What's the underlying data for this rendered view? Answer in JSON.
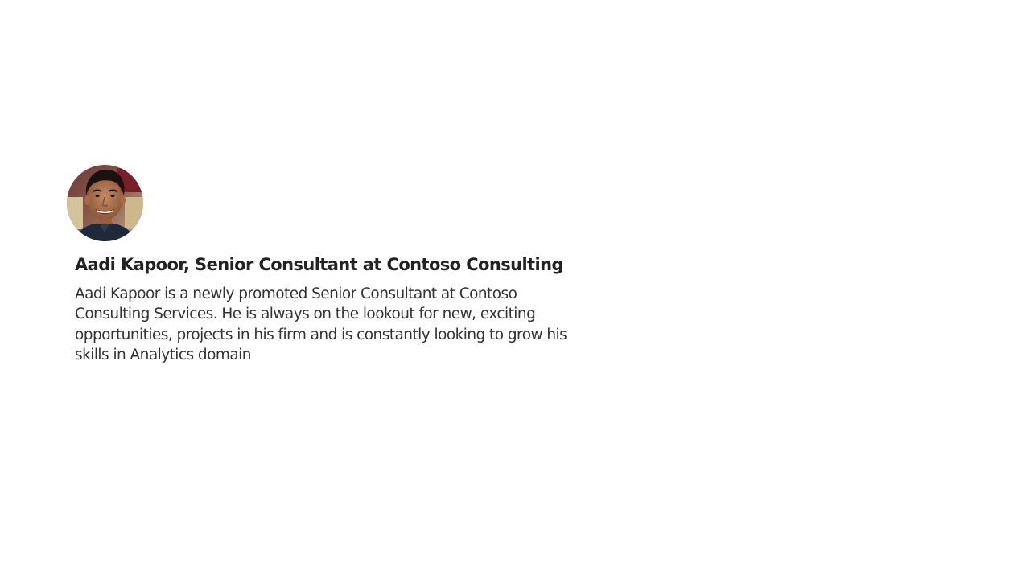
{
  "profile": {
    "avatar_icon": "person-photo-icon",
    "title": "Aadi Kapoor, Senior Consultant at Contoso Consulting",
    "bio": "Aadi Kapoor is a newly promoted Senior Consultant at Contoso Consulting Services. He is always on the lookout for new, exciting opportunities, projects in his firm and is constantly looking to grow his skills in Analytics domain"
  },
  "colors": {
    "background": "#ffffff",
    "title": "#222222",
    "body": "#333333"
  }
}
